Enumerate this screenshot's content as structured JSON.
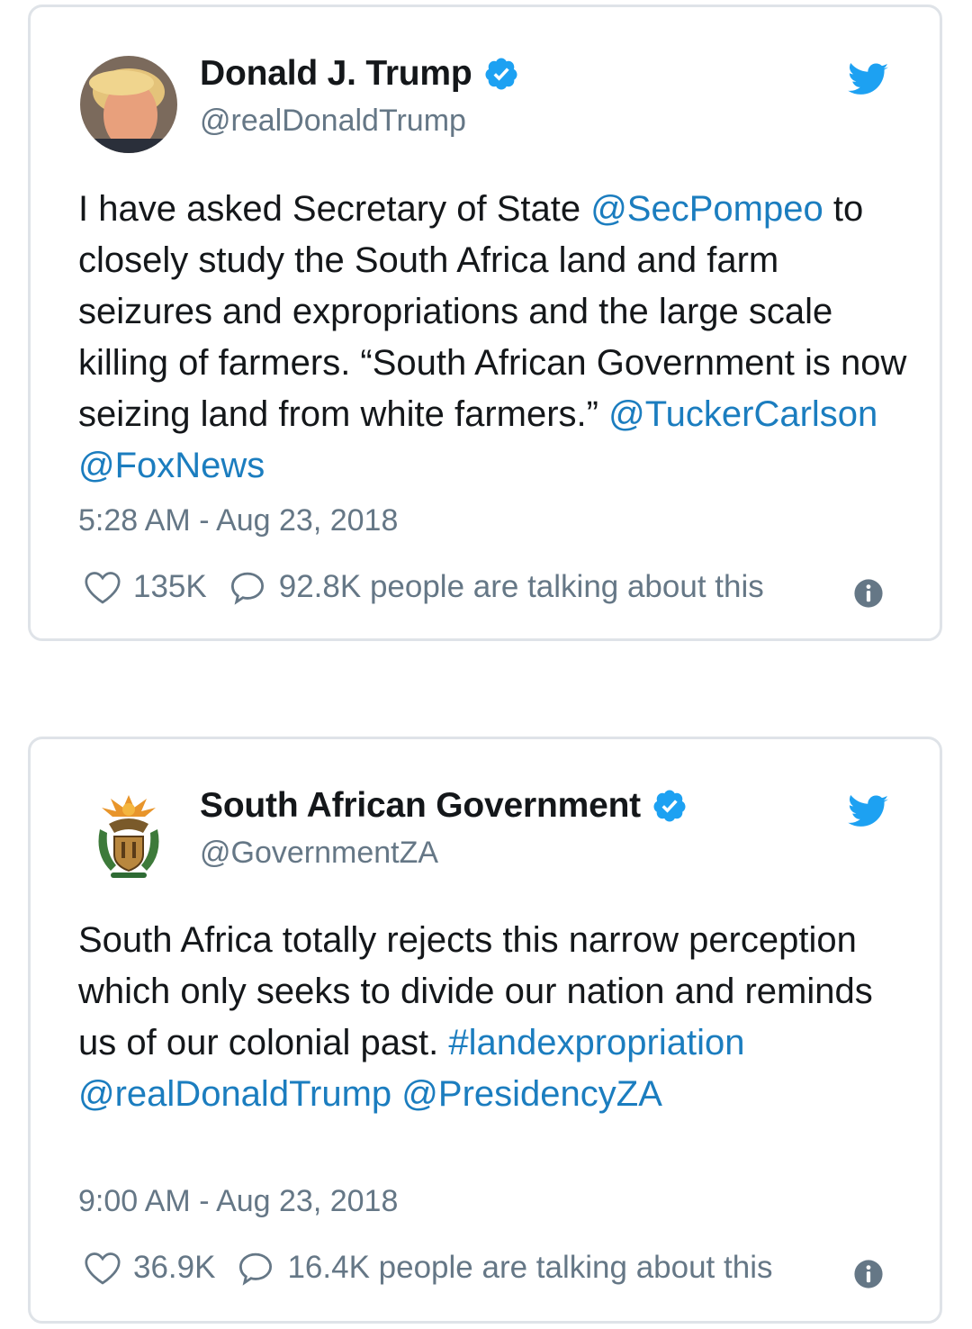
{
  "tweets": [
    {
      "name": "Donald J. Trump",
      "handle": "@realDonaldTrump",
      "avatar_icon": "profile-photo",
      "verified": true,
      "text_parts": [
        {
          "text": "I have asked Secretary of State ",
          "link": false
        },
        {
          "text": "@SecPompeo",
          "link": true
        },
        {
          "text": " to closely study the South Africa land and farm seizures and expropriations and the large scale killing of farmers. “South African Government is now seizing land from white farmers.” ",
          "link": false
        },
        {
          "text": "@TuckerCarlson",
          "link": true
        },
        {
          "text": " ",
          "link": false
        },
        {
          "text": "@FoxNews",
          "link": true
        }
      ],
      "time": "5:28 AM - Aug 23, 2018",
      "likes": "135K",
      "talking": "92.8K people are talking about this"
    },
    {
      "name": "South African Government",
      "handle": "@GovernmentZA",
      "avatar_icon": "coat-of-arms",
      "verified": true,
      "text_parts": [
        {
          "text": "South Africa totally rejects this narrow perception which only seeks to divide our nation and reminds us of our colonial past. ",
          "link": false
        },
        {
          "text": "#landexpropriation",
          "link": true
        },
        {
          "text": " ",
          "link": false
        },
        {
          "text": "@realDonaldTrump",
          "link": true
        },
        {
          "text": " ",
          "link": false
        },
        {
          "text": "@PresidencyZA",
          "link": true
        }
      ],
      "time": "9:00 AM - Aug 23, 2018",
      "likes": "36.9K",
      "talking": "16.4K people are talking about this"
    }
  ],
  "colors": {
    "link": "#1b7dbf",
    "twitter_blue": "#1da1f2",
    "muted": "#657786",
    "border": "#dfe3e8"
  }
}
